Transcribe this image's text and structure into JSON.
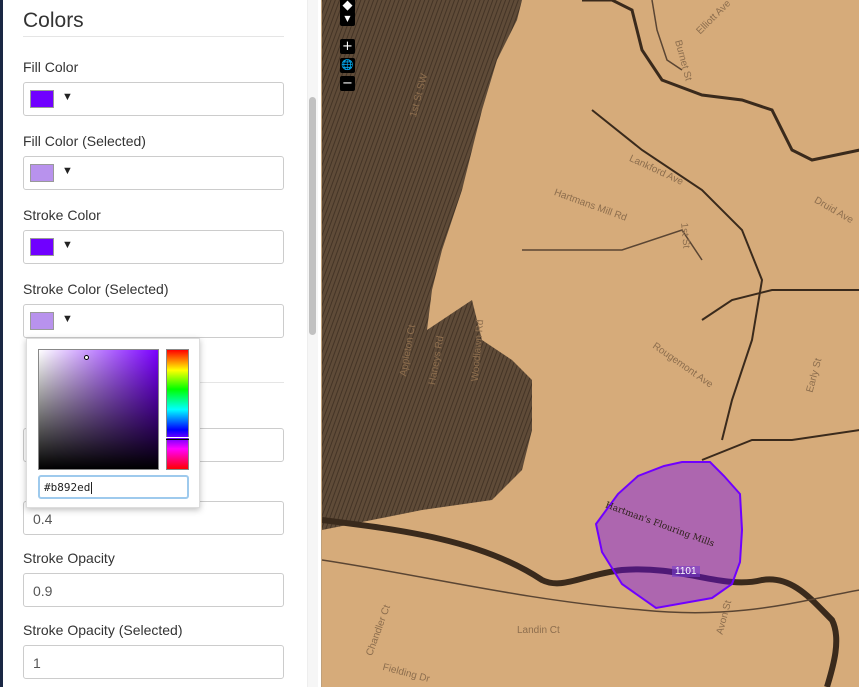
{
  "panel": {
    "title": "Colors",
    "fill_color": {
      "label": "Fill Color",
      "value": "#7000ff"
    },
    "fill_color_selected": {
      "label": "Fill Color (Selected)",
      "value": "#b892ed"
    },
    "stroke_color": {
      "label": "Stroke Color",
      "value": "#7000ff"
    },
    "stroke_color_selected": {
      "label": "Stroke Color (Selected)",
      "value": "#b892ed"
    },
    "caret_glyph": "▼",
    "fill_opacity_selected_value": "0.4",
    "stroke_opacity": {
      "label": "Stroke Opacity",
      "value": "0.9"
    },
    "stroke_opacity_selected": {
      "label": "Stroke Opacity (Selected)",
      "value": "1"
    }
  },
  "color_picker": {
    "hex_value": "#b892ed",
    "hue_color": "#7a00ff"
  },
  "map": {
    "controls": {
      "zoom_in": "+",
      "zoom_out": "−",
      "globe": "🌐",
      "pan": "◆"
    },
    "streets": [
      "Elliott Ave",
      "Burnet St",
      "Lankford Ave",
      "Hartmans Mill Rd",
      "1st St",
      "Druid Ave",
      "Rougemont Ave",
      "Early St",
      "Avon St",
      "Chandler Ct",
      "Landin Ct",
      "Fielding Dr",
      "Woodlawn Rd",
      "1st St SW",
      "Appleton Ct",
      "Haneys Rd"
    ],
    "polygon_label": "1101",
    "polygon_fill": "#7000ff",
    "polygon_stroke": "#7000ff",
    "annotation": "Hartman's Flouring Mills"
  }
}
